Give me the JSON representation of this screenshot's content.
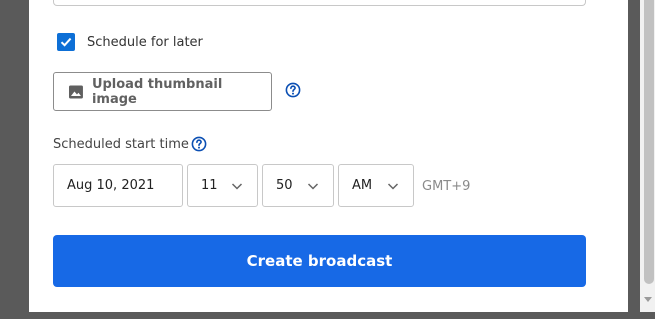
{
  "schedule": {
    "checkbox_label": "Schedule for later",
    "checked": true
  },
  "upload": {
    "label": "Upload thumbnail image",
    "icon": "image-icon"
  },
  "scheduled_start": {
    "label": "Scheduled start time",
    "date": "Aug 10, 2021",
    "hour": "11",
    "minute": "50",
    "period": "AM",
    "timezone": "GMT+9"
  },
  "actions": {
    "create_label": "Create broadcast"
  },
  "colors": {
    "primary": "#1769e6",
    "checkbox": "#0d6fd6",
    "help_icon": "#0b4fb3",
    "backdrop": "#5a5a5a"
  }
}
